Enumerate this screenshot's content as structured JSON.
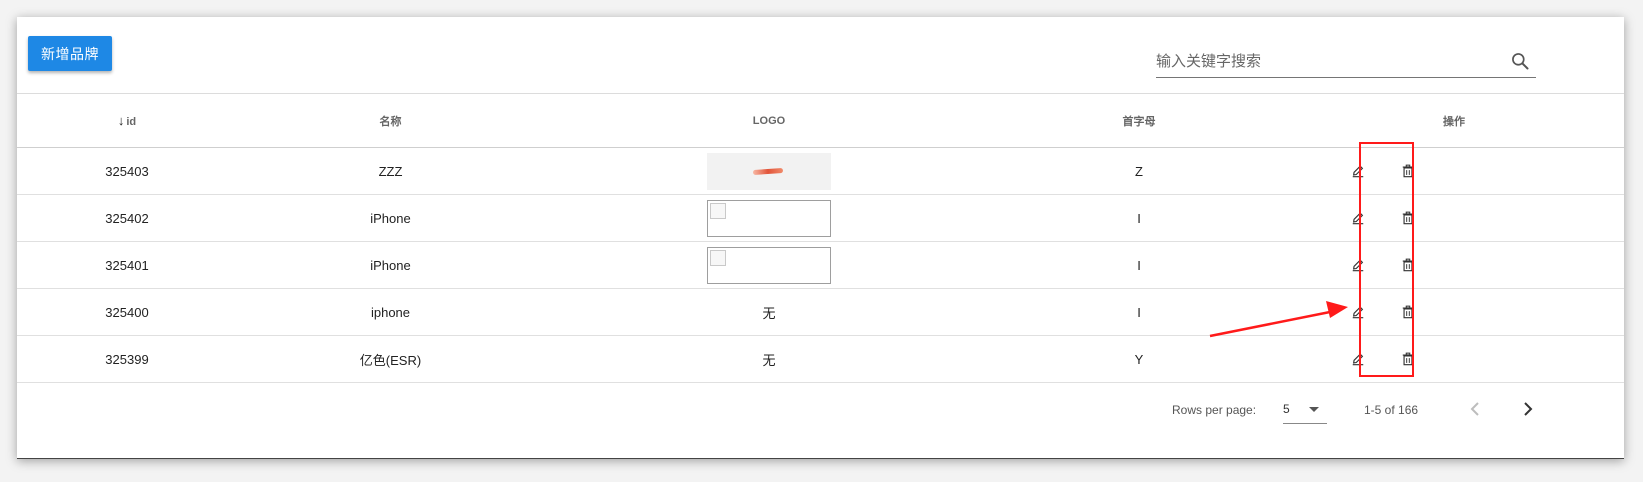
{
  "toolbar": {
    "add_label": "新增品牌"
  },
  "search": {
    "placeholder": "输入关键字搜索",
    "value": "",
    "icon": "search-icon"
  },
  "table": {
    "columns": [
      {
        "key": "id",
        "label": "id",
        "sorted": "desc",
        "sort_icon": "arrow-down"
      },
      {
        "key": "name",
        "label": "名称"
      },
      {
        "key": "logo",
        "label": "LOGO"
      },
      {
        "key": "letter",
        "label": "首字母"
      },
      {
        "key": "actions",
        "label": "操作"
      }
    ],
    "rows": [
      {
        "id": "325403",
        "name": "ZZZ",
        "logo": "image",
        "letter": "Z"
      },
      {
        "id": "325402",
        "name": "iPhone",
        "logo": "broken-image",
        "letter": "I"
      },
      {
        "id": "325401",
        "name": "iPhone",
        "logo": "broken-image",
        "letter": "I"
      },
      {
        "id": "325400",
        "name": "iphone",
        "logo": "无",
        "letter": "I"
      },
      {
        "id": "325399",
        "name": "亿色(ESR)",
        "logo": "无",
        "letter": "Y"
      }
    ],
    "row_actions": [
      "edit-icon",
      "delete-icon"
    ]
  },
  "pagination": {
    "rows_per_page_label": "Rows per page:",
    "rows_per_page_value": "5",
    "range_text": "1-5 of 166"
  },
  "annotations": {
    "highlight_color": "#ff1a1a"
  },
  "colors": {
    "primary": "#1e88e5"
  }
}
